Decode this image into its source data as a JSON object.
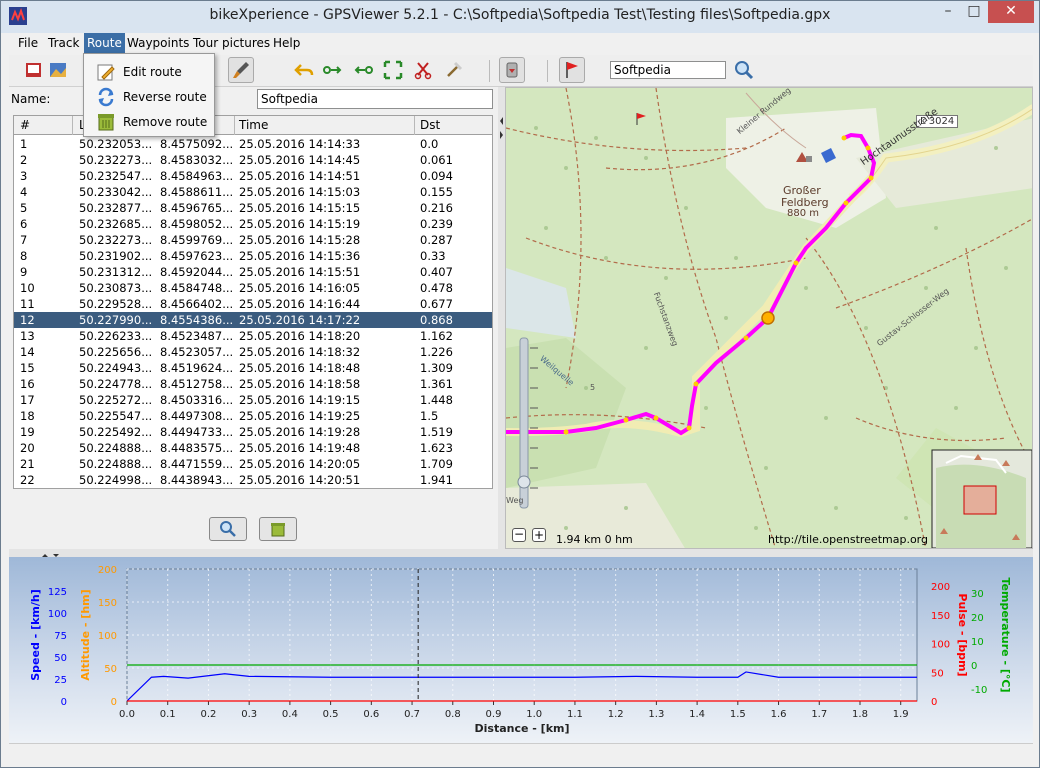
{
  "window": {
    "title": "bikeXperience - GPSViewer 5.2.1 - C:\\Softpedia\\Softpedia Test\\Testing files\\Softpedia.gpx",
    "minimize": "–",
    "maximize": "□",
    "close": "✕"
  },
  "menu": {
    "items": [
      "File",
      "Track",
      "Route",
      "Waypoints",
      "Tour pictures",
      "Help"
    ],
    "active": "Route"
  },
  "route_menu": {
    "items": [
      {
        "label": "Edit route",
        "icon": "edit-route-icon"
      },
      {
        "label": "Reverse route",
        "icon": "reverse-route-icon"
      },
      {
        "label": "Remove route",
        "icon": "remove-route-icon"
      }
    ]
  },
  "toolbar": {
    "search_value": "Softpedia"
  },
  "route": {
    "name_label": "Name:",
    "name_value": "Softpedia",
    "columns": [
      "#",
      "L",
      "",
      "Time",
      "Dst"
    ],
    "selected_index": 11,
    "rows": [
      [
        "1",
        "50.232053...",
        "8.4575092...",
        "25.05.2016 14:14:33",
        "0.0"
      ],
      [
        "2",
        "50.232273...",
        "8.4583032...",
        "25.05.2016 14:14:45",
        "0.061"
      ],
      [
        "3",
        "50.232547...",
        "8.4584963...",
        "25.05.2016 14:14:51",
        "0.094"
      ],
      [
        "4",
        "50.233042...",
        "8.4588611...",
        "25.05.2016 14:15:03",
        "0.155"
      ],
      [
        "5",
        "50.232877...",
        "8.4596765...",
        "25.05.2016 14:15:15",
        "0.216"
      ],
      [
        "6",
        "50.232685...",
        "8.4598052...",
        "25.05.2016 14:15:19",
        "0.239"
      ],
      [
        "7",
        "50.232273...",
        "8.4599769...",
        "25.05.2016 14:15:28",
        "0.287"
      ],
      [
        "8",
        "50.231902...",
        "8.4597623...",
        "25.05.2016 14:15:36",
        "0.33"
      ],
      [
        "9",
        "50.231312...",
        "8.4592044...",
        "25.05.2016 14:15:51",
        "0.407"
      ],
      [
        "10",
        "50.230873...",
        "8.4584748...",
        "25.05.2016 14:16:05",
        "0.478"
      ],
      [
        "11",
        "50.229528...",
        "8.4566402...",
        "25.05.2016 14:16:44",
        "0.677"
      ],
      [
        "12",
        "50.227990...",
        "8.4554386...",
        "25.05.2016 14:17:22",
        "0.868"
      ],
      [
        "13",
        "50.226233...",
        "8.4523487...",
        "25.05.2016 14:18:20",
        "1.162"
      ],
      [
        "14",
        "50.225656...",
        "8.4523057...",
        "25.05.2016 14:18:32",
        "1.226"
      ],
      [
        "15",
        "50.224943...",
        "8.4519624...",
        "25.05.2016 14:18:48",
        "1.309"
      ],
      [
        "16",
        "50.224778...",
        "8.4512758...",
        "25.05.2016 14:18:58",
        "1.361"
      ],
      [
        "17",
        "50.225272...",
        "8.4503316...",
        "25.05.2016 14:19:15",
        "1.448"
      ],
      [
        "18",
        "50.225547...",
        "8.4497308...",
        "25.05.2016 14:19:25",
        "1.5"
      ],
      [
        "19",
        "50.225492...",
        "8.4494733...",
        "25.05.2016 14:19:28",
        "1.519"
      ],
      [
        "20",
        "50.224888...",
        "8.4483575...",
        "25.05.2016 14:19:48",
        "1.623"
      ],
      [
        "21",
        "50.224888...",
        "8.4471559...",
        "25.05.2016 14:20:05",
        "1.709"
      ],
      [
        "22",
        "50.224998...",
        "8.4438943...",
        "25.05.2016 14:20:51",
        "1.941"
      ]
    ]
  },
  "map": {
    "labels": {
      "peak_name": "Großer",
      "peak_name2": "Feldberg",
      "peak_elev": "880 m",
      "road_l3024": "L 3024",
      "hochtaunus": "Hochtaunusstraße",
      "kleiner_rundweg": "Kleiner Rundweg",
      "fuchstanz": "Fuchstanzweg",
      "gustav": "Gustav-Schlosser-Weg",
      "weilquelle": "Weilquelle",
      "weg_label": "Weg",
      "five": "5"
    },
    "scale_text": "1.94 km 0 hm",
    "attribution": "http://tile.openstreetmap.org",
    "zoom_level_fraction": 0.3
  },
  "chart_data": {
    "type": "line",
    "xlabel": "Distance - [km]",
    "x_ticks": [
      "0.0",
      "0.1",
      "0.2",
      "0.3",
      "0.4",
      "0.5",
      "0.6",
      "0.7",
      "0.8",
      "0.9",
      "1.0",
      "1.1",
      "1.2",
      "1.3",
      "1.4",
      "1.5",
      "1.6",
      "1.7",
      "1.8",
      "1.9"
    ],
    "xlim": [
      0,
      1.94
    ],
    "cursor_x": 0.715,
    "axes": {
      "speed": {
        "label": "Speed - [km/h]",
        "ticks": [
          "0",
          "25",
          "50",
          "75",
          "100",
          "125"
        ],
        "ylim": [
          0,
          150
        ],
        "color": "#0000ff"
      },
      "altitude": {
        "label": "Altitude - [hm]",
        "ticks": [
          "0",
          "50",
          "100",
          "150",
          "200"
        ],
        "ylim": [
          0,
          200
        ],
        "color": "#ff9900"
      },
      "pulse": {
        "label": "Pulse - [bpm]",
        "ticks": [
          "0",
          "50",
          "100",
          "150",
          "200"
        ],
        "ylim": [
          0,
          230
        ],
        "color": "#ff0000"
      },
      "temperature": {
        "label": "Temperature - [°C]",
        "ticks": [
          "-10",
          "0",
          "10",
          "20",
          "30"
        ],
        "ylim": [
          -15,
          40
        ],
        "color": "#00aa00"
      }
    },
    "series": [
      {
        "name": "Speed - [km/h]",
        "axis": "speed",
        "color": "#0000ff",
        "x": [
          0.0,
          0.06,
          0.09,
          0.15,
          0.24,
          0.3,
          0.5,
          0.7,
          0.9,
          1.1,
          1.25,
          1.4,
          1.5,
          1.52,
          1.6,
          1.94
        ],
        "y": [
          0,
          27,
          28,
          26,
          31,
          28,
          27,
          27,
          27,
          27,
          28,
          27,
          27,
          33,
          27,
          27
        ]
      },
      {
        "name": "Temperature - [°C]",
        "axis": "temperature",
        "color": "#00aa00",
        "x": [
          0.0,
          1.94
        ],
        "y": [
          0,
          0
        ]
      },
      {
        "name": "Pulse - [bpm]",
        "axis": "pulse",
        "color": "#ff0000",
        "x": [
          0.0,
          1.94
        ],
        "y": [
          0,
          0
        ]
      }
    ]
  }
}
